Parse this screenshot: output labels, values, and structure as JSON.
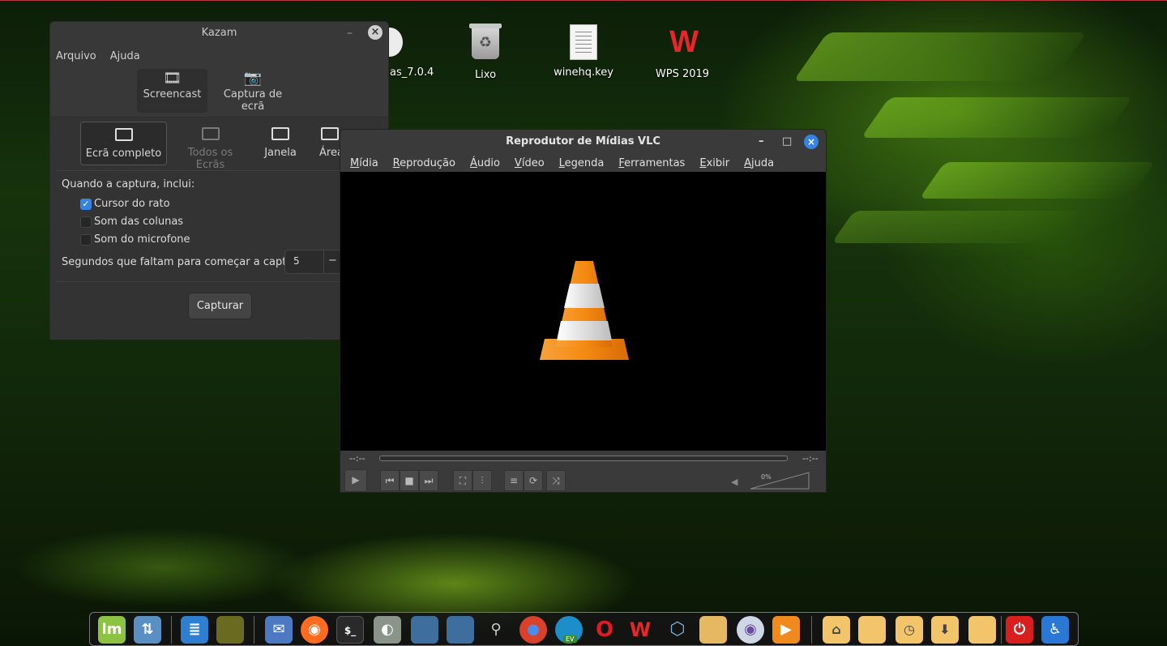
{
  "desktop": {
    "icons": [
      {
        "label": "as_7.0.4",
        "icon": "disc-icon"
      },
      {
        "label": "Lixo",
        "icon": "trash-icon"
      },
      {
        "label": "winehq.key",
        "icon": "document-icon"
      },
      {
        "label": "WPS 2019",
        "icon": "wps-icon"
      }
    ]
  },
  "kazam": {
    "title": "Kazam",
    "menu": [
      "Arquivo",
      "Ajuda"
    ],
    "modes": [
      {
        "label": "Screencast",
        "icon": "film-icon",
        "active": true
      },
      {
        "label": "Captura de ecrã",
        "icon": "camera-icon",
        "active": false
      }
    ],
    "sources": [
      {
        "label": "Ecrã completo",
        "state": "active"
      },
      {
        "label": "Todos os Ecrãs",
        "state": "disabled"
      },
      {
        "label": "Janela",
        "state": "normal"
      },
      {
        "label": "Área",
        "state": "normal"
      }
    ],
    "include_label": "Quando a captura, inclui:",
    "options": [
      {
        "label": "Cursor do rato",
        "checked": true
      },
      {
        "label": "Som das colunas",
        "checked": false
      },
      {
        "label": "Som do microfone",
        "checked": false
      }
    ],
    "countdown_label": "Segundos que faltam para começar a captura",
    "countdown_value": "5",
    "capture_button": "Capturar"
  },
  "vlc": {
    "title": "Reprodutor de Mídias VLC",
    "menu": [
      "Mídia",
      "Reprodução",
      "Áudio",
      "Vídeo",
      "Legenda",
      "Ferramentas",
      "Exibir",
      "Ajuda"
    ],
    "time_left": "--:--",
    "time_right": "--:--",
    "volume_text": "0%",
    "volume_level": 0
  },
  "dock": {
    "apps": [
      "linux-mint-menu-icon",
      "update-manager-icon",
      "text-editor-icon",
      "photo-viewer-icon",
      "mail-icon",
      "firefox-icon",
      "terminal-icon",
      "settings-icon",
      "desktop-icon",
      "desktop-icon",
      "search-icon",
      "chrome-icon",
      "edge-icon",
      "opera-icon",
      "wps-icon",
      "virtualbox-icon",
      "files-icon",
      "webcam-icon",
      "media-player-icon",
      "home-folder-icon",
      "documents-folder-icon",
      "recent-folder-icon",
      "downloads-folder-icon",
      "folder-icon",
      "power-icon",
      "accessibility-icon"
    ],
    "edge_badge": "EV"
  },
  "colors": {
    "accent": "#3584e4",
    "wps_red": "#e8262a",
    "vlc_orange": "#f08a1c"
  }
}
